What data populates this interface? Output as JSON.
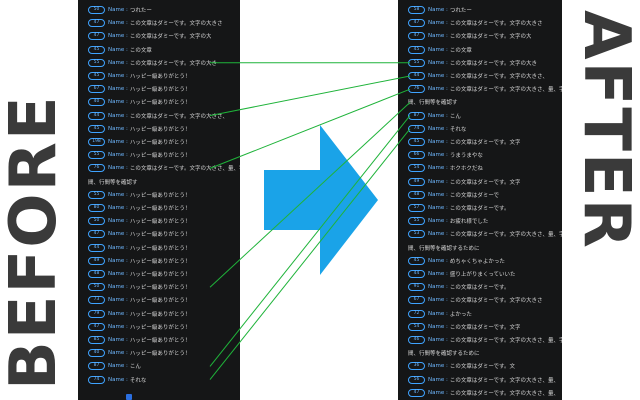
{
  "labels": {
    "before": "BEFORE",
    "after": "AFTER"
  },
  "colors": {
    "panel_bg": "#151617",
    "accent_blue": "#3fa3ff",
    "arrow_blue": "#1aa3e8",
    "line_green": "#1fb33a",
    "label_gray": "#3a3a3a"
  },
  "before": [
    {
      "n": "50",
      "name": "Name",
      "text": "つれたー"
    },
    {
      "n": "47",
      "name": "Name",
      "text": "この文章はダミーです。文字の大きさ"
    },
    {
      "n": "47",
      "name": "Name",
      "text": "この文章はダミーです。文字の大"
    },
    {
      "n": "45",
      "name": "Name",
      "text": "この文章"
    },
    {
      "n": "55",
      "name": "Name",
      "text": "この文章はダミーです。文字の大き"
    },
    {
      "n": "45",
      "name": "Name",
      "text": "ハッピー級ありがとう！"
    },
    {
      "n": "67",
      "name": "Name",
      "text": "ハッピー級ありがとう！"
    },
    {
      "n": "40",
      "name": "Name",
      "text": "ハッピー級ありがとう！"
    },
    {
      "n": "44",
      "name": "Name",
      "text": "この文章はダミーです。文字の大きさ、"
    },
    {
      "n": "45",
      "name": "Name",
      "text": "ハッピー級ありがとう！"
    },
    {
      "n": "198",
      "name": "Name",
      "text": "ハッピー級ありがとう！"
    },
    {
      "n": "55",
      "name": "Name",
      "text": "ハッピー級ありがとう！"
    },
    {
      "n": "76",
      "name": "Name",
      "text": "この文章はダミーです。文字の大きさ、量、字"
    },
    {
      "n": "",
      "name": "",
      "text": "間、行間等を確認す"
    },
    {
      "n": "55",
      "name": "Name",
      "text": "ハッピー級ありがとう！"
    },
    {
      "n": "80",
      "name": "Name",
      "text": "ハッピー級ありがとう！"
    },
    {
      "n": "50",
      "name": "Name",
      "text": "ハッピー級ありがとう！"
    },
    {
      "n": "47",
      "name": "Name",
      "text": "ハッピー級ありがとう！"
    },
    {
      "n": "44",
      "name": "Name",
      "text": "ハッピー級ありがとう！"
    },
    {
      "n": "49",
      "name": "Name",
      "text": "ハッピー級ありがとう！"
    },
    {
      "n": "48",
      "name": "Name",
      "text": "ハッピー級ありがとう！"
    },
    {
      "n": "50",
      "name": "Name",
      "text": "ハッピー級ありがとう！"
    },
    {
      "n": "73",
      "name": "Name",
      "text": "ハッピー級ありがとう！"
    },
    {
      "n": "79",
      "name": "Name",
      "text": "ハッピー級ありがとう！"
    },
    {
      "n": "47",
      "name": "Name",
      "text": "ハッピー級ありがとう！"
    },
    {
      "n": "85",
      "name": "Name",
      "text": "ハッピー級ありがとう！"
    },
    {
      "n": "40",
      "name": "Name",
      "text": "ハッピー級ありがとう！"
    },
    {
      "n": "87",
      "name": "Name",
      "text": "こん"
    },
    {
      "n": "74",
      "name": "Name",
      "text": "それな"
    }
  ],
  "after": [
    {
      "n": "58",
      "name": "Name",
      "text": "つれたー"
    },
    {
      "n": "47",
      "name": "Name",
      "text": "この文章はダミーです。文字の大きさ"
    },
    {
      "n": "47",
      "name": "Name",
      "text": "この文章はダミーです。文字の大"
    },
    {
      "n": "45",
      "name": "Name",
      "text": "この文章"
    },
    {
      "n": "55",
      "name": "Name",
      "text": "この文章はダミーです。文字の大き"
    },
    {
      "n": "44",
      "name": "Name",
      "text": "この文章はダミーです。文字の大きさ、"
    },
    {
      "n": "76",
      "name": "Name",
      "text": "この文章はダミーです。文字の大きさ、量、字"
    },
    {
      "n": "",
      "name": "",
      "text": "間、行間等を確認す"
    },
    {
      "n": "87",
      "name": "Name",
      "text": "こん"
    },
    {
      "n": "74",
      "name": "Name",
      "text": "それな"
    },
    {
      "n": "45",
      "name": "Name",
      "text": "この文章はダミーです。文字"
    },
    {
      "n": "66",
      "name": "Name",
      "text": "うまうまやな"
    },
    {
      "n": "54",
      "name": "Name",
      "text": "ホクホクだね"
    },
    {
      "n": "49",
      "name": "Name",
      "text": "この文章はダミーです。文字"
    },
    {
      "n": "48",
      "name": "Name",
      "text": "この文章はダミーで"
    },
    {
      "n": "57",
      "name": "Name",
      "text": "この文章はダミーです。"
    },
    {
      "n": "55",
      "name": "Name",
      "text": "お疲れ様でした"
    },
    {
      "n": "53",
      "name": "Name",
      "text": "この文章はダミーです。文字の大きさ、量、字"
    },
    {
      "n": "",
      "name": "",
      "text": "間、行間等を確認するために"
    },
    {
      "n": "45",
      "name": "Name",
      "text": "めちゃくちゃよかった"
    },
    {
      "n": "44",
      "name": "Name",
      "text": "盛り上がりまくっていいた"
    },
    {
      "n": "91",
      "name": "Name",
      "text": "この文章はダミーです。"
    },
    {
      "n": "67",
      "name": "Name",
      "text": "この文章はダミーです。文字の大きさ"
    },
    {
      "n": "72",
      "name": "Name",
      "text": "よかった"
    },
    {
      "n": "54",
      "name": "Name",
      "text": "この文章はダミーです。文字"
    },
    {
      "n": "46",
      "name": "Name",
      "text": "この文章はダミーです。文字の大きさ、量、字"
    },
    {
      "n": "",
      "name": "",
      "text": "間、行間等を確認するために"
    },
    {
      "n": "36",
      "name": "Name",
      "text": "この文章はダミーです。文"
    },
    {
      "n": "56",
      "name": "Name",
      "text": "この文章はダミーです。文字の大きさ、量、"
    },
    {
      "n": "47",
      "name": "Name",
      "text": "この文章はダミーです。文字の大きさ、量、"
    }
  ],
  "mappings": [
    [
      4,
      4
    ],
    [
      8,
      5
    ],
    [
      12,
      6
    ],
    [
      27,
      8
    ],
    [
      28,
      9
    ],
    [
      21,
      7
    ]
  ]
}
